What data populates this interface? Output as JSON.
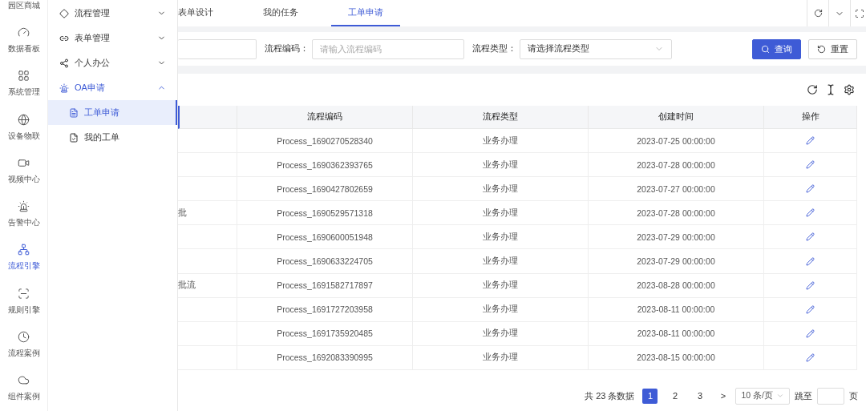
{
  "nav_rail": {
    "items": [
      {
        "label": "园区商城",
        "selected": false
      },
      {
        "label": "数据看板",
        "selected": false
      },
      {
        "label": "系统管理",
        "selected": false
      },
      {
        "label": "设备物联",
        "selected": false
      },
      {
        "label": "视频中心",
        "selected": false
      },
      {
        "label": "告警中心",
        "selected": false
      },
      {
        "label": "流程引擎",
        "selected": true
      },
      {
        "label": "规则引擎",
        "selected": false
      },
      {
        "label": "流程案例",
        "selected": false
      },
      {
        "label": "组件案例",
        "selected": false
      }
    ]
  },
  "menu": {
    "groups": [
      {
        "label": "流程管理",
        "expanded": false,
        "selected": false
      },
      {
        "label": "表单管理",
        "expanded": false,
        "selected": false
      },
      {
        "label": "个人办公",
        "expanded": false,
        "selected": false
      },
      {
        "label": "OA申请",
        "expanded": true,
        "selected": true,
        "children": [
          {
            "label": "工单申请",
            "selected": true
          },
          {
            "label": "我的工单",
            "selected": false
          }
        ]
      }
    ]
  },
  "tabs": [
    {
      "label": "表单设计",
      "selected": false
    },
    {
      "label": "我的任务",
      "selected": false
    },
    {
      "label": "工单申请",
      "selected": true
    }
  ],
  "filters": [
    {
      "kind": "input",
      "label": "流程编码：",
      "placeholder": "请输入流程编码"
    },
    {
      "kind": "select",
      "label": "流程类型：",
      "placeholder": "请选择流程类型"
    }
  ],
  "buttons": [
    {
      "kind": "primary",
      "label": "查询"
    },
    {
      "kind": "default",
      "label": "重置"
    }
  ],
  "table": {
    "columns": [
      "流程编码",
      "流程类型",
      "创建时间",
      "操作"
    ],
    "rows": [
      {
        "code": "Process_1690270528340",
        "type": "业务办理",
        "created": "2023-07-25 00:00:00"
      },
      {
        "code": "Process_1690362393765",
        "type": "业务办理",
        "created": "2023-07-28 00:00:00"
      },
      {
        "code": "Process_1690427802659",
        "type": "业务办理",
        "created": "2023-07-27 00:00:00"
      },
      {
        "column_1": "批",
        "code": "Process_1690529571318",
        "type": "业务办理",
        "created": "2023-07-28 00:00:00"
      },
      {
        "code": "Process_1690600051948",
        "type": "业务办理",
        "created": "2023-07-29 00:00:00"
      },
      {
        "code": "Process_1690633224705",
        "type": "业务办理",
        "created": "2023-07-29 00:00:00"
      },
      {
        "column_1": "批流",
        "code": "Process_1691582717897",
        "type": "业务办理",
        "created": "2023-08-28 00:00:00"
      },
      {
        "code": "Process_1691727203958",
        "type": "业务办理",
        "created": "2023-08-11 00:00:00"
      },
      {
        "code": "Process_1691735920485",
        "type": "业务办理",
        "created": "2023-08-11 00:00:00"
      },
      {
        "code": "Process_1692083390995",
        "type": "业务办理",
        "created": "2023-08-15 00:00:00"
      }
    ]
  },
  "pagination": {
    "total": "共 23 条数据",
    "pages": [
      {
        "label": "1",
        "selected": true
      },
      {
        "label": "2",
        "selected": false
      },
      {
        "label": "3",
        "selected": false
      }
    ],
    "next": ">",
    "page_size": "10 条/页",
    "jump_label": "跳至",
    "page_unit": "页"
  }
}
